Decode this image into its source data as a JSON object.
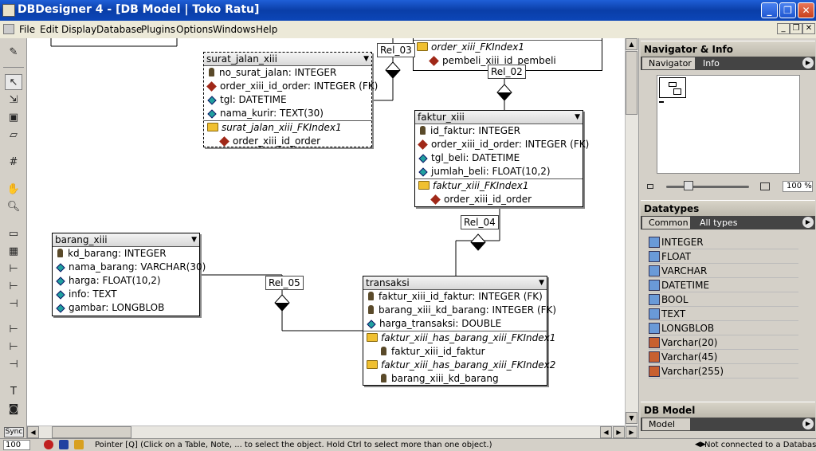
{
  "window": {
    "title": "DBDesigner 4 - [DB Model | Toko Ratu]"
  },
  "menu": [
    "File",
    "Edit",
    "Display",
    "Database",
    "Plugins",
    "Options",
    "Windows",
    "Help"
  ],
  "tables": {
    "surat_jalan": {
      "name": "surat_jalan_xiii",
      "rows": [
        {
          "kind": "key",
          "text": "no_surat_jalan: INTEGER"
        },
        {
          "kind": "fk",
          "text": "order_xiii_id_order: INTEGER (FK)"
        },
        {
          "kind": "attr",
          "text": "tgl: DATETIME"
        },
        {
          "kind": "attr",
          "text": "nama_kurir: TEXT(30)"
        }
      ],
      "index": "surat_jalan_xiii_FKIndex1",
      "index_col": "order_xiii_id_order"
    },
    "order_partial": {
      "index": "order_xiii_FKIndex1",
      "index_col": "pembeli_xiii_id_pembeli"
    },
    "faktur": {
      "name": "faktur_xiii",
      "rows": [
        {
          "kind": "key",
          "text": "id_faktur: INTEGER"
        },
        {
          "kind": "fk",
          "text": "order_xiii_id_order: INTEGER (FK)"
        },
        {
          "kind": "attr",
          "text": "tgl_beli: DATETIME"
        },
        {
          "kind": "attr",
          "text": "jumlah_beli: FLOAT(10,2)"
        }
      ],
      "index": "faktur_xiii_FKIndex1",
      "index_col": "order_xiii_id_order"
    },
    "barang": {
      "name": "barang_xiii",
      "rows": [
        {
          "kind": "key",
          "text": "kd_barang: INTEGER"
        },
        {
          "kind": "attr",
          "text": "nama_barang: VARCHAR(30)"
        },
        {
          "kind": "attr",
          "text": "harga: FLOAT(10,2)"
        },
        {
          "kind": "attr",
          "text": "info: TEXT"
        },
        {
          "kind": "attr",
          "text": "gambar: LONGBLOB"
        }
      ]
    },
    "transaksi": {
      "name": "transaksi",
      "rows": [
        {
          "kind": "key",
          "text": "faktur_xiii_id_faktur: INTEGER (FK)"
        },
        {
          "kind": "key",
          "text": "barang_xiii_kd_barang: INTEGER (FK)"
        },
        {
          "kind": "attr",
          "text": "harga_transaksi: DOUBLE"
        }
      ],
      "index1": "faktur_xiii_has_barang_xiii_FKIndex1",
      "index1_col": "faktur_xiii_id_faktur",
      "index2": "faktur_xiii_has_barang_xiii_FKIndex2",
      "index2_col": "barang_xiii_kd_barang"
    }
  },
  "relations": [
    "Rel_03",
    "Rel_02",
    "Rel_04",
    "Rel_05"
  ],
  "panel": {
    "navigator": {
      "title": "Navigator & Info",
      "tabs": [
        "Navigator",
        "Info"
      ],
      "zoom": "100 %"
    },
    "datatypes": {
      "title": "Datatypes",
      "tabs": [
        "Common",
        "All types"
      ],
      "items": [
        "INTEGER",
        "FLOAT",
        "VARCHAR",
        "DATETIME",
        "BOOL",
        "TEXT",
        "LONGBLOB",
        "Varchar(20)",
        "Varchar(45)",
        "Varchar(255)"
      ]
    },
    "dbmodel": {
      "title": "DB Model",
      "tabs": [
        "Model"
      ]
    }
  },
  "status": {
    "zoom": "100 %",
    "text": "Pointer [Q] (Click on a Table, Note, ... to select the object. Hold Ctrl to select more than one object.)",
    "connection": "Not connected to a Database"
  },
  "icons": {
    "sync_label": "Sync"
  }
}
